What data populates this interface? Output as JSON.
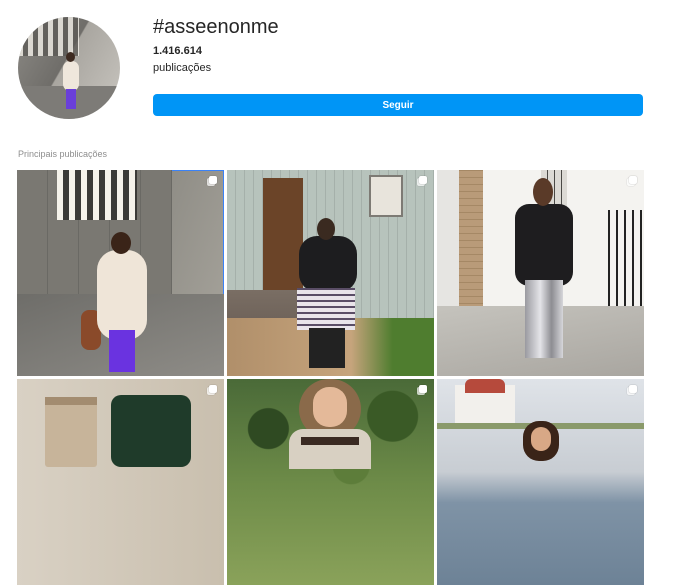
{
  "profile": {
    "hashtag": "#asseenonme",
    "post_count": "1.416.614",
    "post_count_label": "publicações",
    "follow_label": "Seguir",
    "accent_color": "#0095f6"
  },
  "section": {
    "title": "Principais publicações"
  },
  "posts": [
    {
      "id": "post-1",
      "multi_icon": "carousel-icon",
      "selected": true
    },
    {
      "id": "post-2",
      "multi_icon": "carousel-icon",
      "selected": false
    },
    {
      "id": "post-3",
      "multi_icon": "carousel-icon",
      "selected": false
    },
    {
      "id": "post-4",
      "multi_icon": "carousel-icon",
      "selected": false
    },
    {
      "id": "post-5",
      "multi_icon": "carousel-icon",
      "selected": false
    },
    {
      "id": "post-6",
      "multi_icon": "carousel-icon",
      "selected": false
    }
  ]
}
